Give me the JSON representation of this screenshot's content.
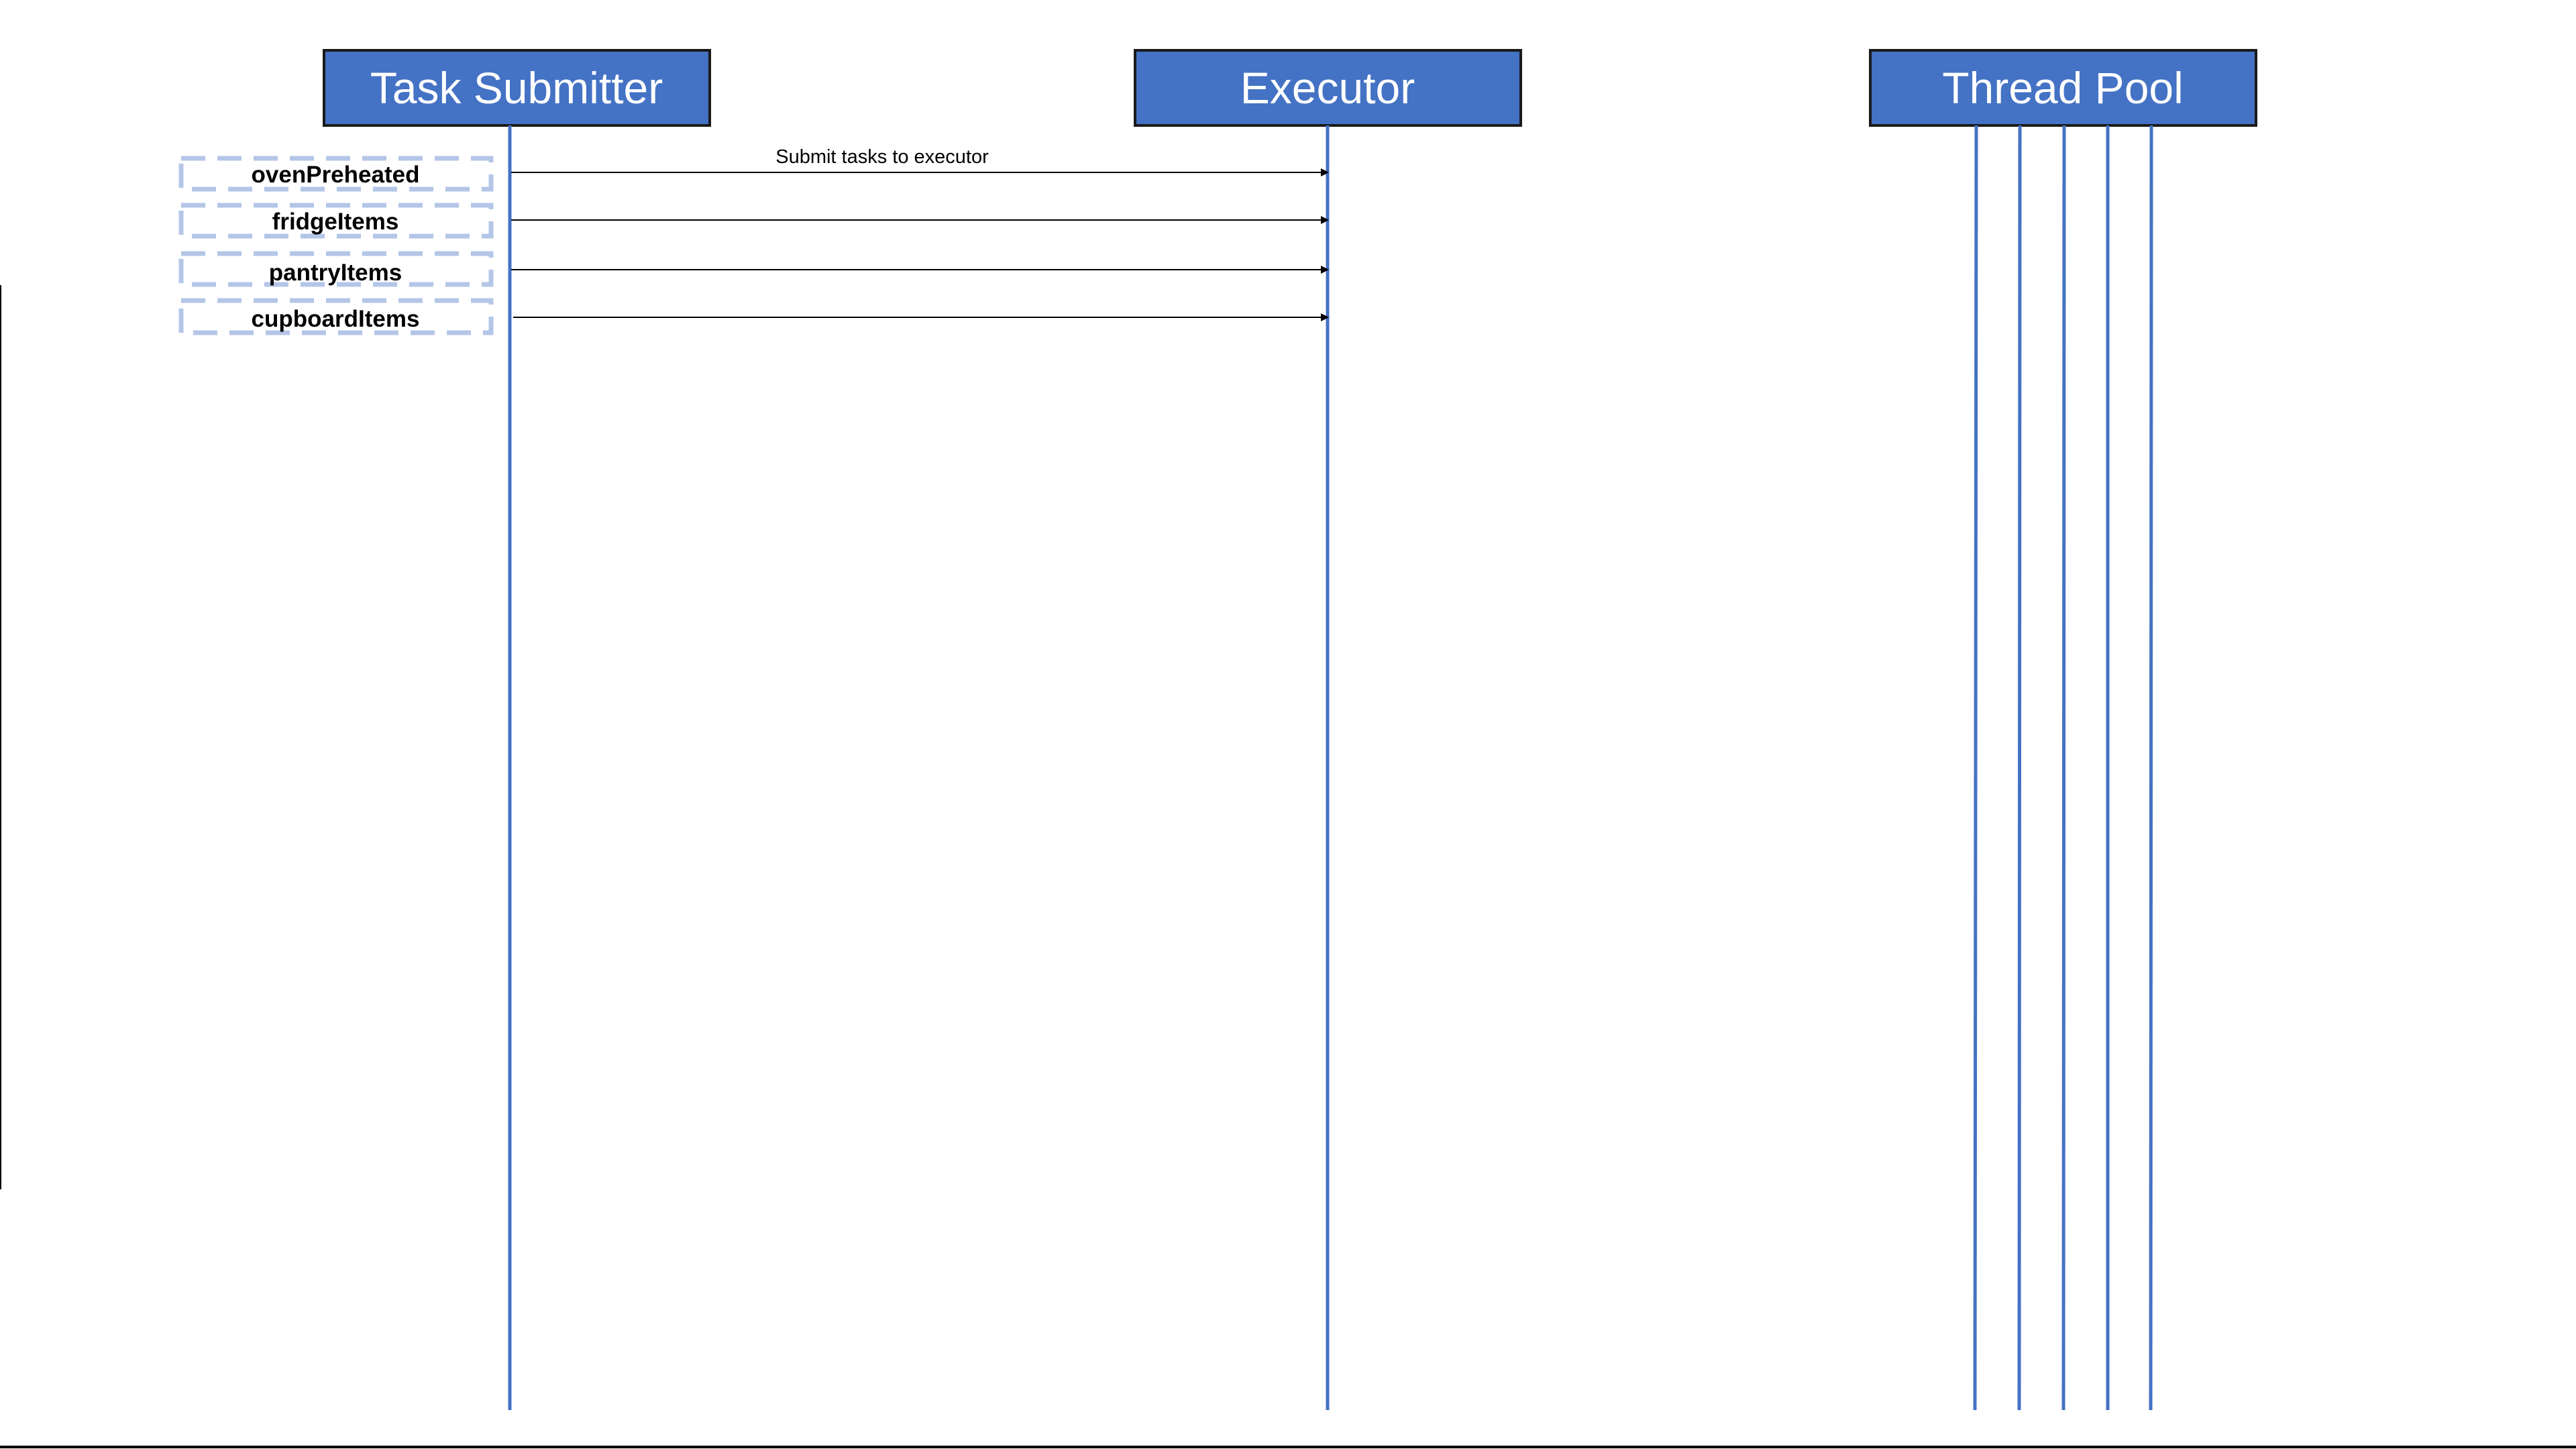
{
  "diagram": {
    "type": "sequence",
    "participants": [
      {
        "id": "submitter",
        "label": "Task Submitter"
      },
      {
        "id": "executor",
        "label": "Executor"
      },
      {
        "id": "pool",
        "label": "Thread Pool",
        "thread_count": 5
      }
    ],
    "tasks": [
      {
        "label": "ovenPreheated"
      },
      {
        "label": "fridgeItems"
      },
      {
        "label": "pantryItems"
      },
      {
        "label": "cupboardItems"
      }
    ],
    "messages": [
      {
        "from": "submitter",
        "to": "executor",
        "label": "Submit tasks to executor"
      },
      {
        "from": "submitter",
        "to": "executor",
        "label": ""
      },
      {
        "from": "submitter",
        "to": "executor",
        "label": ""
      },
      {
        "from": "submitter",
        "to": "executor",
        "label": ""
      }
    ]
  },
  "colors": {
    "participant_fill": "#4472c4",
    "participant_border": "#1a1a1a",
    "participant_text": "#ffffff",
    "lifeline": "#4472c4",
    "task_border": "#b4c6e7",
    "arrow": "#000000",
    "text": "#000000",
    "frame": "#000000"
  }
}
